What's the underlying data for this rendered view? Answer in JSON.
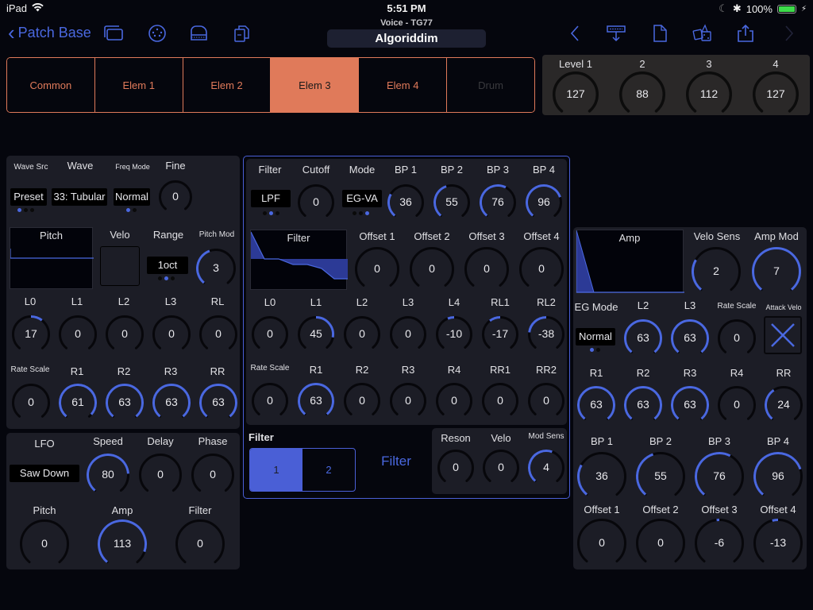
{
  "status_bar": {
    "device": "iPad",
    "time": "5:51 PM",
    "battery": "100%"
  },
  "nav": {
    "back_label": "Patch Base",
    "subtitle": "Voice - TG77",
    "title": "Algoriddim",
    "left_icons": [
      "windows-icon",
      "midi-port-icon",
      "piano-icon",
      "documents-icon"
    ],
    "right_icons": [
      "back-chevron-icon",
      "send-to-synth-icon",
      "new-document-icon",
      "randomize-dice-icon",
      "share-icon",
      "forward-chevron-icon"
    ]
  },
  "colors": {
    "accent_orange": "#e07a5a",
    "accent_blue": "#4a68e0",
    "panel_bg": "#1c1d26",
    "bg": "#05060d"
  },
  "element_tabs": [
    {
      "label": "Common",
      "state": "normal"
    },
    {
      "label": "Elem 1",
      "state": "normal"
    },
    {
      "label": "Elem 2",
      "state": "normal"
    },
    {
      "label": "Elem 3",
      "state": "active"
    },
    {
      "label": "Elem 4",
      "state": "normal"
    },
    {
      "label": "Drum",
      "state": "disabled"
    }
  ],
  "levels": [
    {
      "label": "Level 1",
      "value": 127,
      "max": 127
    },
    {
      "label": "2",
      "value": 88,
      "max": 127
    },
    {
      "label": "3",
      "value": 112,
      "max": 127
    },
    {
      "label": "4",
      "value": 127,
      "max": 127
    }
  ],
  "osc": {
    "wave_src_label": "Wave Src",
    "wave_src_value": "Preset",
    "wave_src_dots": [
      1,
      0,
      0
    ],
    "wave_label": "Wave",
    "wave_value": "33: Tubular",
    "freq_mode_label": "Freq Mode",
    "freq_mode_value": "Normal",
    "freq_mode_dots": [
      1,
      0
    ],
    "fine": {
      "label": "Fine",
      "value": 0,
      "min": -7,
      "max": 7
    },
    "pitch_graph_title": "Pitch",
    "velo_label": "Velo",
    "range_label": "Range",
    "range_value": "1oct",
    "range_dots": [
      0,
      1,
      0
    ],
    "pitch_mod": {
      "label": "Pitch Mod",
      "value": 3,
      "min": 0,
      "max": 7
    }
  },
  "pitch_eg": {
    "levels": [
      {
        "label": "L0",
        "value": 17,
        "min": -64,
        "max": 63
      },
      {
        "label": "L1",
        "value": 0,
        "min": -64,
        "max": 63
      },
      {
        "label": "L2",
        "value": 0,
        "min": -64,
        "max": 63
      },
      {
        "label": "L3",
        "value": 0,
        "min": -64,
        "max": 63
      },
      {
        "label": "RL",
        "value": 0,
        "min": -64,
        "max": 63
      }
    ],
    "rates": [
      {
        "label": "Rate Scale",
        "value": 0,
        "min": 0,
        "max": 7
      },
      {
        "label": "R1",
        "value": 61,
        "min": 0,
        "max": 63
      },
      {
        "label": "R2",
        "value": 63,
        "min": 0,
        "max": 63
      },
      {
        "label": "R3",
        "value": 63,
        "min": 0,
        "max": 63
      },
      {
        "label": "RR",
        "value": 63,
        "min": 0,
        "max": 63
      }
    ]
  },
  "lfo": {
    "label": "LFO",
    "wave_value": "Saw Down",
    "top": [
      {
        "label": "Speed",
        "value": 80,
        "min": 0,
        "max": 99
      },
      {
        "label": "Delay",
        "value": 0,
        "min": 0,
        "max": 99
      },
      {
        "label": "Phase",
        "value": 0,
        "min": 0,
        "max": 99
      }
    ],
    "bottom": [
      {
        "label": "Pitch",
        "value": 0,
        "min": 0,
        "max": 127
      },
      {
        "label": "Amp",
        "value": 113,
        "min": 0,
        "max": 127
      },
      {
        "label": "Filter",
        "value": 0,
        "min": 0,
        "max": 127
      }
    ]
  },
  "filter": {
    "type_label": "Filter",
    "type_value": "LPF",
    "type_dots": [
      0,
      1,
      0
    ],
    "cutoff": {
      "label": "Cutoff",
      "value": 0,
      "min": 0,
      "max": 127
    },
    "mode_label": "Mode",
    "mode_value": "EG-VA",
    "mode_dots": [
      0,
      0,
      1
    ],
    "bps": [
      {
        "label": "BP 1",
        "value": 36,
        "min": 0,
        "max": 127
      },
      {
        "label": "BP 2",
        "value": 55,
        "min": 0,
        "max": 127
      },
      {
        "label": "BP 3",
        "value": 76,
        "min": 0,
        "max": 127
      },
      {
        "label": "BP 4",
        "value": 96,
        "min": 0,
        "max": 127
      }
    ],
    "graph_title": "Filter",
    "offsets": [
      {
        "label": "Offset 1",
        "value": 0,
        "min": -127,
        "max": 127
      },
      {
        "label": "Offset 2",
        "value": 0,
        "min": -127,
        "max": 127
      },
      {
        "label": "Offset 3",
        "value": 0,
        "min": -127,
        "max": 127
      },
      {
        "label": "Offset 4",
        "value": 0,
        "min": -127,
        "max": 127
      }
    ],
    "levels": [
      {
        "label": "L0",
        "value": 0,
        "min": -64,
        "max": 63
      },
      {
        "label": "L1",
        "value": 45,
        "min": -64,
        "max": 63
      },
      {
        "label": "L2",
        "value": 0,
        "min": -64,
        "max": 63
      },
      {
        "label": "L3",
        "value": 0,
        "min": -64,
        "max": 63
      },
      {
        "label": "L4",
        "value": -10,
        "min": -64,
        "max": 63
      },
      {
        "label": "RL1",
        "value": -17,
        "min": -64,
        "max": 63
      },
      {
        "label": "RL2",
        "value": -38,
        "min": -64,
        "max": 63
      }
    ],
    "rates": [
      {
        "label": "Rate Scale",
        "value": 0,
        "min": 0,
        "max": 7
      },
      {
        "label": "R1",
        "value": 63,
        "min": 0,
        "max": 63
      },
      {
        "label": "R2",
        "value": 0,
        "min": 0,
        "max": 63
      },
      {
        "label": "R3",
        "value": 0,
        "min": 0,
        "max": 63
      },
      {
        "label": "R4",
        "value": 0,
        "min": 0,
        "max": 63
      },
      {
        "label": "RR1",
        "value": 0,
        "min": 0,
        "max": 63
      },
      {
        "label": "RR2",
        "value": 0,
        "min": 0,
        "max": 63
      }
    ],
    "select_label": "Filter",
    "select_options": [
      {
        "label": "1",
        "active": true
      },
      {
        "label": "2",
        "active": false
      }
    ],
    "section_title": "Filter",
    "bottom": [
      {
        "label": "Reson",
        "value": 0,
        "min": 0,
        "max": 99
      },
      {
        "label": "Velo",
        "value": 0,
        "min": 0,
        "max": 7
      },
      {
        "label": "Mod Sens",
        "value": 4,
        "min": 0,
        "max": 7
      }
    ]
  },
  "amp": {
    "graph_title": "Amp",
    "velo_sens": {
      "label": "Velo Sens",
      "value": 2,
      "min": 0,
      "max": 7
    },
    "amp_mod": {
      "label": "Amp Mod",
      "value": 7,
      "min": 0,
      "max": 7
    },
    "eg_mode_label": "EG Mode",
    "eg_mode_value": "Normal",
    "eg_mode_dots": [
      1,
      0
    ],
    "l2": {
      "label": "L2",
      "value": 63,
      "min": 0,
      "max": 63
    },
    "l3": {
      "label": "L3",
      "value": 63,
      "min": 0,
      "max": 63
    },
    "rate_scale": {
      "label": "Rate Scale",
      "value": 0,
      "min": 0,
      "max": 7
    },
    "attack_velo_label": "Attack Velo",
    "rates": [
      {
        "label": "R1",
        "value": 63,
        "min": 0,
        "max": 63
      },
      {
        "label": "R2",
        "value": 63,
        "min": 0,
        "max": 63
      },
      {
        "label": "R3",
        "value": 63,
        "min": 0,
        "max": 63
      },
      {
        "label": "R4",
        "value": 0,
        "min": 0,
        "max": 63
      },
      {
        "label": "RR",
        "value": 24,
        "min": 0,
        "max": 63
      }
    ],
    "bps": [
      {
        "label": "BP 1",
        "value": 36,
        "min": 0,
        "max": 127
      },
      {
        "label": "BP 2",
        "value": 55,
        "min": 0,
        "max": 127
      },
      {
        "label": "BP 3",
        "value": 76,
        "min": 0,
        "max": 127
      },
      {
        "label": "BP 4",
        "value": 96,
        "min": 0,
        "max": 127
      }
    ],
    "offsets": [
      {
        "label": "Offset 1",
        "value": 0,
        "min": -127,
        "max": 127
      },
      {
        "label": "Offset 2",
        "value": 0,
        "min": -127,
        "max": 127
      },
      {
        "label": "Offset 3",
        "value": -6,
        "min": -127,
        "max": 127
      },
      {
        "label": "Offset 4",
        "value": -13,
        "min": -127,
        "max": 127
      }
    ]
  }
}
